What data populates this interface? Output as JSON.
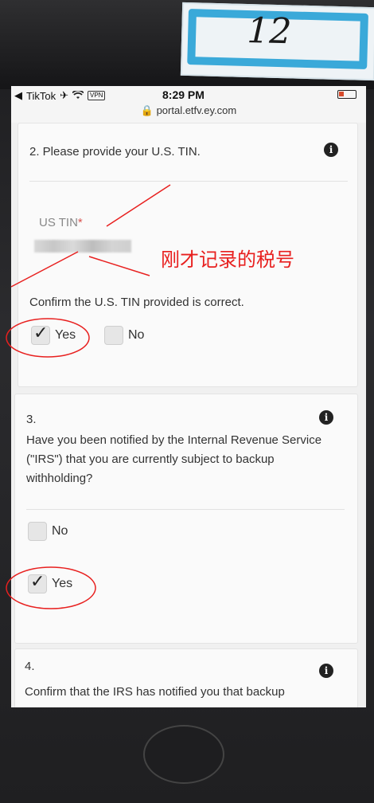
{
  "sticker": {
    "label": "12"
  },
  "statusbar": {
    "app": "TikTok",
    "vpn": "VPN",
    "time": "8:29 PM"
  },
  "urlbar": {
    "url": "portal.etfv.ey.com"
  },
  "q2": {
    "title": "2. Please provide your U.S. TIN.",
    "field_label": "US TIN",
    "required_mark": "*",
    "confirm_text": "Confirm the U.S. TIN provided is correct.",
    "options": [
      {
        "label": "Yes",
        "checked": true
      },
      {
        "label": "No",
        "checked": false
      }
    ]
  },
  "q3": {
    "number": "3.",
    "title": "Have you been notified by the Internal Revenue Service (\"IRS\") that you are currently subject to backup withholding?",
    "options": [
      {
        "label": "No",
        "checked": false
      },
      {
        "label": "Yes",
        "checked": true
      }
    ]
  },
  "q4": {
    "number": "4.",
    "title": "Confirm that the IRS has notified you that backup"
  },
  "annotation": {
    "text": "刚才记录的税号",
    "color": "#e8201f"
  },
  "icons": {
    "info": "info-icon",
    "lock": "lock-icon",
    "check": "check-icon"
  }
}
